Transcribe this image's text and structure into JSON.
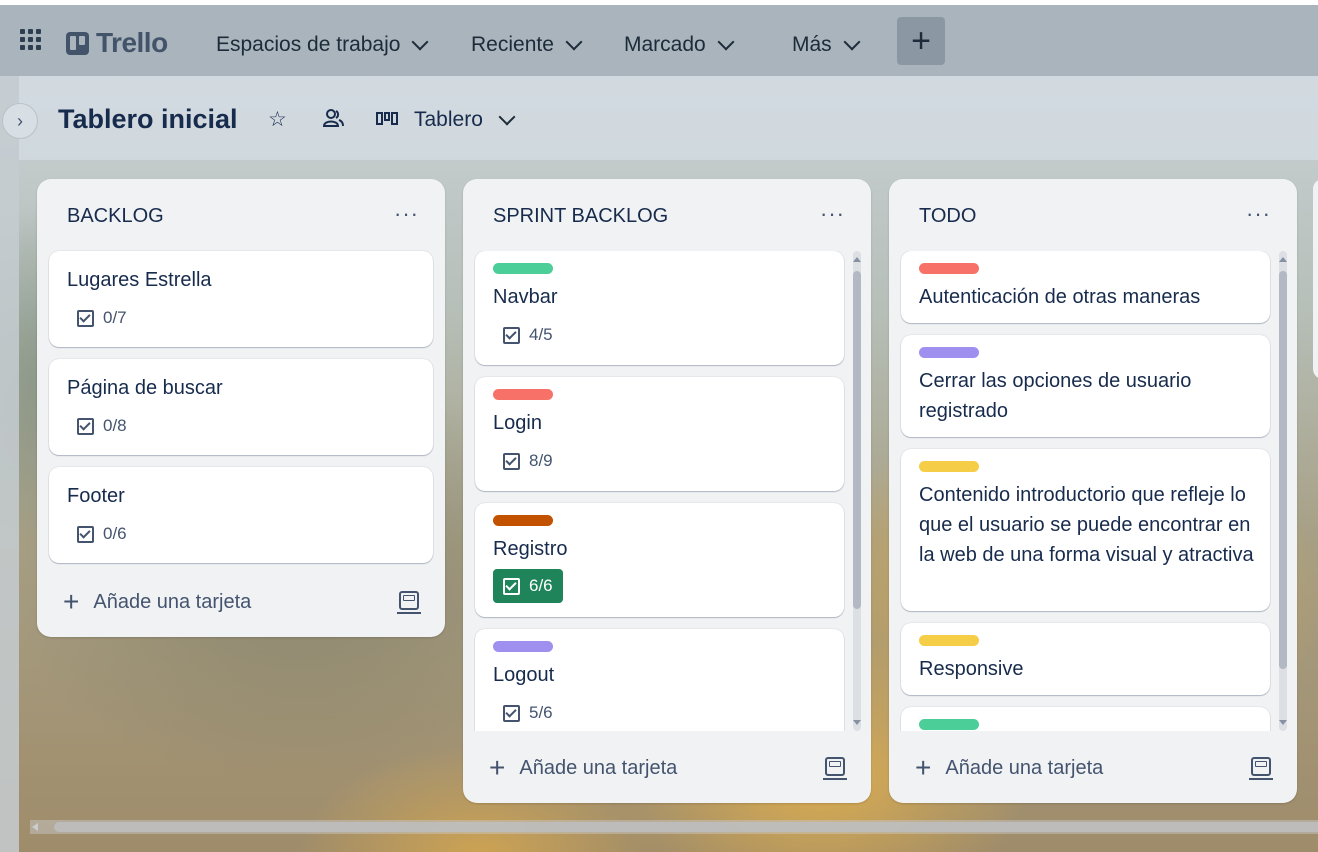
{
  "topbar": {
    "logo": "Trello",
    "nav": [
      "Espacios de trabajo",
      "Reciente",
      "Marcado",
      "Más"
    ],
    "create": "+"
  },
  "board": {
    "title": "Tablero inicial",
    "view": "Tablero",
    "expand": "›"
  },
  "lists": [
    {
      "title": "BACKLOG",
      "menu": "···",
      "add_label": "Añade una tarjeta",
      "cards": [
        {
          "title": "Lugares Estrella",
          "checklist": "0/7"
        },
        {
          "title": "Página de buscar",
          "checklist": "0/8"
        },
        {
          "title": "Footer",
          "checklist": "0/6"
        }
      ]
    },
    {
      "title": "SPRINT BACKLOG",
      "menu": "···",
      "add_label": "Añade una tarjeta",
      "cards": [
        {
          "label_color": "#4bce97",
          "title": "Navbar",
          "checklist": "4/5"
        },
        {
          "label_color": "#f87168",
          "title": "Login",
          "checklist": "8/9"
        },
        {
          "label_color": "#c25100",
          "title": "Registro",
          "checklist": "6/6",
          "complete": true
        },
        {
          "label_color": "#9f8fef",
          "title": "Logout",
          "checklist": "5/6"
        }
      ]
    },
    {
      "title": "TODO",
      "menu": "···",
      "add_label": "Añade una tarjeta",
      "cards": [
        {
          "label_color": "#f87168",
          "title": "Autenticación de otras maneras"
        },
        {
          "label_color": "#9f8fef",
          "title": "Cerrar las opciones de usuario registrado"
        },
        {
          "label_color": "#f5cd47",
          "title": "Contenido introductorio que refleje lo que el usuario se puede encontrar en la web de una forma visual y atractiva"
        },
        {
          "label_color": "#f5cd47",
          "title": "Responsive"
        },
        {
          "label_color": "#4bce97",
          "title": ""
        }
      ]
    }
  ]
}
